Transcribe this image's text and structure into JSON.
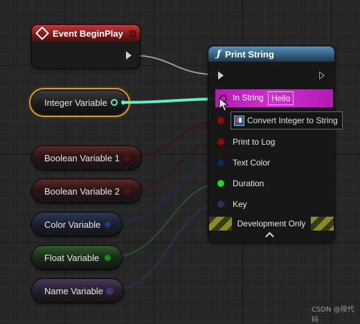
{
  "colors": {
    "exec": "#cfcfcf",
    "integer": "#5ff0c8",
    "boolean": "#8a1010",
    "color": "#1a3a7a",
    "float": "#2fd02f",
    "name": "#5a3a7a",
    "string": "#e040e0",
    "selection": "#e09a1c"
  },
  "event_node": {
    "title": "Event BeginPlay",
    "icon": "event-diamond-icon"
  },
  "variables": [
    {
      "id": "integer",
      "label": "Integer Variable",
      "selected": true
    },
    {
      "id": "bool1",
      "label": "Boolean Variable 1"
    },
    {
      "id": "bool2",
      "label": "Boolean Variable 2"
    },
    {
      "id": "color",
      "label": "Color Variable"
    },
    {
      "id": "float",
      "label": "Float Variable"
    },
    {
      "id": "name",
      "label": "Name Variable"
    }
  ],
  "print_node": {
    "icon": "function-icon",
    "title": "Print String",
    "in_string_label": "In String",
    "in_string_value": "Hello",
    "pins": [
      "Print to Log",
      "Text Color",
      "Duration",
      "Key"
    ],
    "dev_banner": "Development Only"
  },
  "tooltip": {
    "text": "Convert Integer to String",
    "icon": "conversion-node-icon"
  },
  "watermark": "CSDN @按代码"
}
